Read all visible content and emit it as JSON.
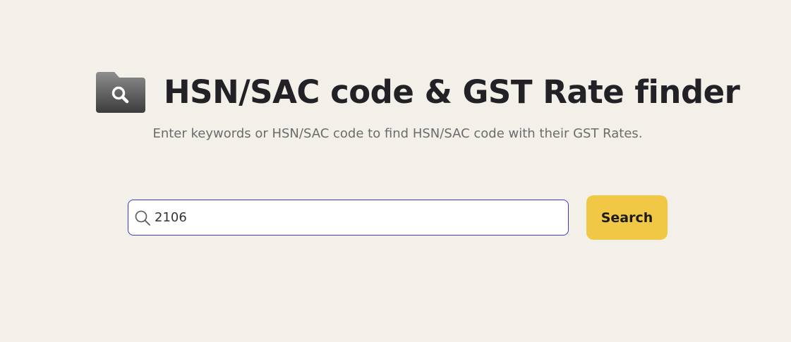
{
  "header": {
    "icon": "folder-search-icon",
    "title": "HSN/SAC code & GST Rate finder",
    "subtitle": "Enter keywords or HSN/SAC code to find HSN/SAC code with their GST Rates."
  },
  "search": {
    "icon": "search-icon",
    "value": "2106",
    "button_label": "Search"
  },
  "colors": {
    "background": "#f3f0ea",
    "title": "#222226",
    "subtitle": "#6b6b6b",
    "input_border": "#3f3ac0",
    "button_background": "#f0c846"
  }
}
